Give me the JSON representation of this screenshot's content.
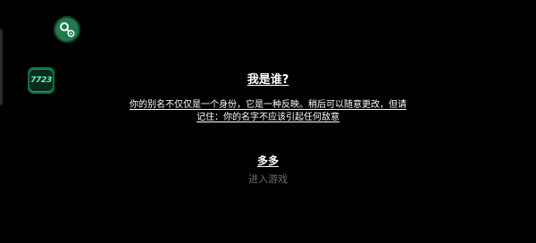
{
  "floating_widgets": {
    "tool_icon": "key-gear-icon",
    "badge_label": "7723"
  },
  "dialog": {
    "title": "我是谁?",
    "description": "你的别名不仅仅是一个身份，它是一种反映。稍后可以随意更改，但请记住：你的名字不应该引起任何敌意",
    "name_value": "多多",
    "enter_label": "进入游戏"
  },
  "colors": {
    "background": "#000000",
    "accent_green": "#11b26b",
    "muted_text": "#6d6d6d"
  }
}
